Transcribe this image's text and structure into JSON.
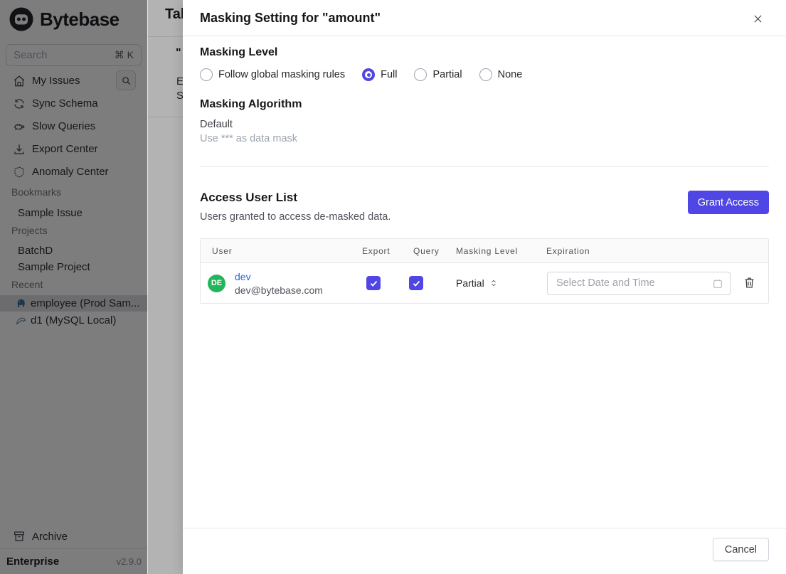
{
  "sidebar": {
    "logo_text": "Bytebase",
    "search": {
      "placeholder": "Search",
      "shortcut": "⌘ K"
    },
    "nav": [
      {
        "icon": "home-icon",
        "label": "My Issues"
      },
      {
        "icon": "sync-icon",
        "label": "Sync Schema"
      },
      {
        "icon": "turtle-icon",
        "label": "Slow Queries"
      },
      {
        "icon": "download-icon",
        "label": "Export Center"
      },
      {
        "icon": "shield-icon",
        "label": "Anomaly Center"
      }
    ],
    "sections": [
      {
        "title": "Bookmarks",
        "items": [
          {
            "label": "Sample Issue"
          }
        ]
      },
      {
        "title": "Projects",
        "items": [
          {
            "label": "BatchD"
          },
          {
            "label": "Sample Project"
          }
        ]
      },
      {
        "title": "Recent",
        "items": [
          {
            "icon": "postgres-icon",
            "label": "employee (Prod Sam..."
          },
          {
            "icon": "mysql-icon",
            "label": "d1 (MySQL Local)"
          }
        ]
      }
    ],
    "archive_label": "Archive",
    "plan": "Enterprise",
    "version": "v2.9.0"
  },
  "background_page": {
    "title_fragment": "Tab",
    "quote_fragment": "\"",
    "fragment_e": "E",
    "fragment_s": "S"
  },
  "modal": {
    "title": "Masking Setting for \"amount\"",
    "masking_level": {
      "heading": "Masking Level",
      "options": [
        "Follow global masking rules",
        "Full",
        "Partial",
        "None"
      ],
      "selected": "Full"
    },
    "masking_algorithm": {
      "heading": "Masking Algorithm",
      "name": "Default",
      "description": "Use *** as data mask"
    },
    "access": {
      "heading": "Access User List",
      "description": "Users granted to access de-masked data.",
      "grant_button": "Grant Access",
      "table": {
        "columns": [
          "User",
          "Export",
          "Query",
          "Masking Level",
          "Expiration"
        ],
        "rows": [
          {
            "avatar": "DE",
            "name": "dev",
            "email": "dev@bytebase.com",
            "export_checked": true,
            "query_checked": true,
            "masking_level": "Partial",
            "expiration_placeholder": "Select Date and Time"
          }
        ]
      }
    },
    "cancel_button": "Cancel"
  },
  "colors": {
    "accent": "#4f46e5",
    "link": "#2563eb",
    "avatar_green": "#23b559"
  }
}
